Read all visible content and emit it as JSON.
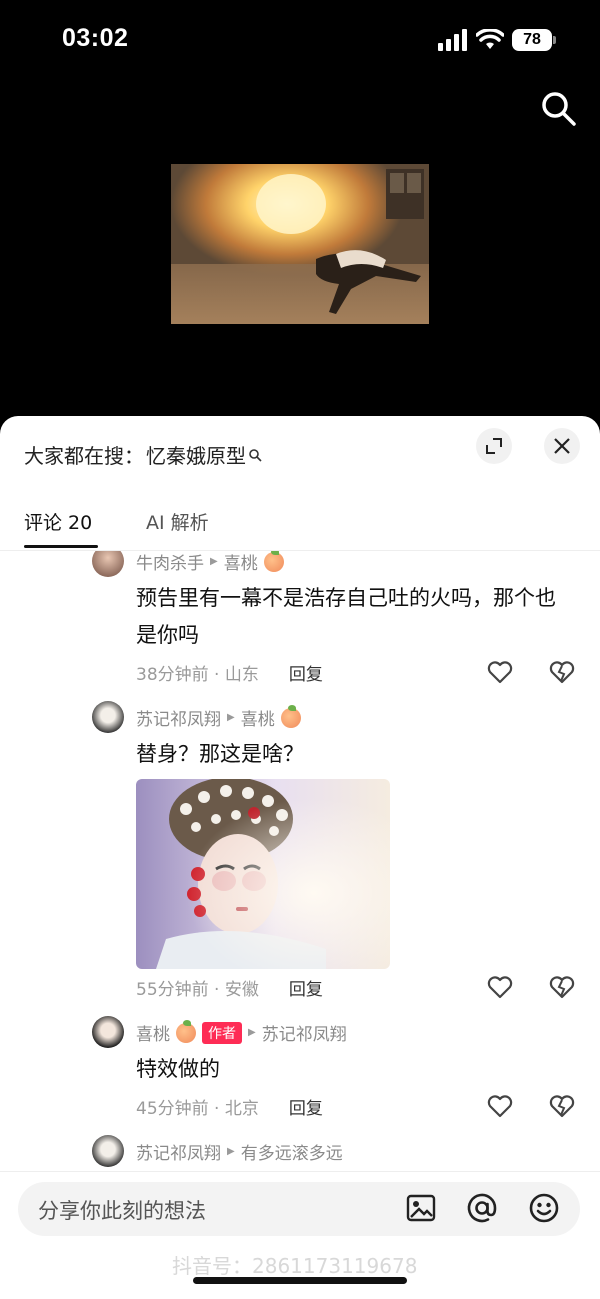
{
  "status_bar": {
    "time": "03:02",
    "battery": "78"
  },
  "suggest": {
    "prefix": "大家都在搜：",
    "query": "忆秦娥原型"
  },
  "tabs": {
    "comments": "评论 20",
    "ai": "AI 解析"
  },
  "comments": [
    {
      "user": "牛肉杀手",
      "reply_to": "喜桃",
      "text": "预告里有一幕不是浩存自己吐的火吗，那个也是你吗",
      "time": "38分钟前 · 山东",
      "reply": "回复"
    },
    {
      "user": "苏记祁凤翔",
      "reply_to": "喜桃",
      "text": "替身？那这是啥？",
      "time": "55分钟前 · 安徽",
      "reply": "回复"
    },
    {
      "user": "喜桃",
      "badge": "作者",
      "reply_to": "苏记祁凤翔",
      "text": "特效做的",
      "time": "45分钟前 · 北京",
      "reply": "回复"
    },
    {
      "user": "苏记祁凤翔",
      "reply_to": "有多远滚多远"
    }
  ],
  "input": {
    "placeholder": "分享你此刻的想法"
  },
  "watermark": "抖音号：2861173119678",
  "icons": [
    "search-icon",
    "expand-icon",
    "close-icon",
    "heart-icon",
    "broken-heart-icon",
    "image-icon",
    "at-icon",
    "emoji-icon"
  ]
}
